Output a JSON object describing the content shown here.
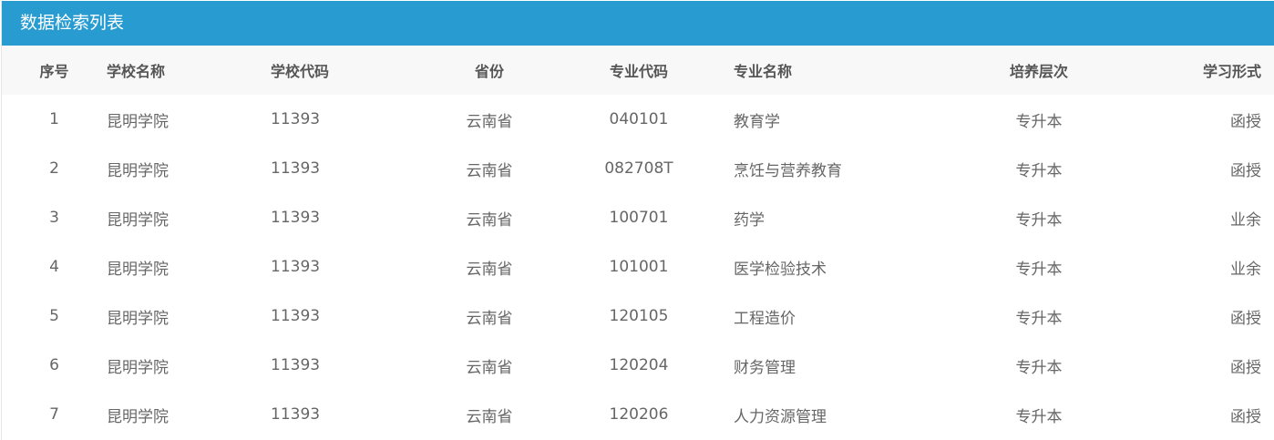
{
  "panel": {
    "title": "数据检索列表"
  },
  "table": {
    "headers": {
      "index": "序号",
      "school_name": "学校名称",
      "school_code": "学校代码",
      "province": "省份",
      "major_code": "专业代码",
      "major_name": "专业名称",
      "level": "培养层次",
      "study_form": "学习形式"
    },
    "rows": [
      {
        "index": "1",
        "school_name": "昆明学院",
        "school_code": "11393",
        "province": "云南省",
        "major_code": "040101",
        "major_name": "教育学",
        "level": "专升本",
        "study_form": "函授"
      },
      {
        "index": "2",
        "school_name": "昆明学院",
        "school_code": "11393",
        "province": "云南省",
        "major_code": "082708T",
        "major_name": "烹饪与营养教育",
        "level": "专升本",
        "study_form": "函授"
      },
      {
        "index": "3",
        "school_name": "昆明学院",
        "school_code": "11393",
        "province": "云南省",
        "major_code": "100701",
        "major_name": "药学",
        "level": "专升本",
        "study_form": "业余"
      },
      {
        "index": "4",
        "school_name": "昆明学院",
        "school_code": "11393",
        "province": "云南省",
        "major_code": "101001",
        "major_name": "医学检验技术",
        "level": "专升本",
        "study_form": "业余"
      },
      {
        "index": "5",
        "school_name": "昆明学院",
        "school_code": "11393",
        "province": "云南省",
        "major_code": "120105",
        "major_name": "工程造价",
        "level": "专升本",
        "study_form": "函授"
      },
      {
        "index": "6",
        "school_name": "昆明学院",
        "school_code": "11393",
        "province": "云南省",
        "major_code": "120204",
        "major_name": "财务管理",
        "level": "专升本",
        "study_form": "函授"
      },
      {
        "index": "7",
        "school_name": "昆明学院",
        "school_code": "11393",
        "province": "云南省",
        "major_code": "120206",
        "major_name": "人力资源管理",
        "level": "专升本",
        "study_form": "函授"
      }
    ]
  },
  "colors": {
    "header_bg": "#289cd1",
    "table_head_bg": "#f8f8f8"
  }
}
